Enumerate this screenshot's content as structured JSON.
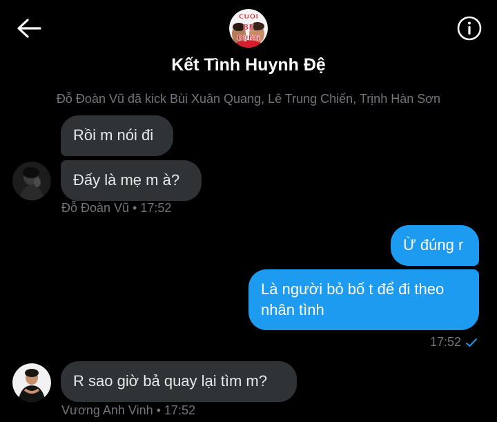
{
  "header": {
    "title": "Kết Tình Huynh Đệ",
    "avatar_text": [
      "CƯỜI",
      "BỂ",
      "BỤNG"
    ],
    "back_icon": "arrow-left-icon",
    "info_icon": "info-icon"
  },
  "system_message": "Đỗ Đoàn Vũ đã kick Bùi Xuân Quang, Lê Trung Chiến, Trịnh Hàn Sơn",
  "messages": [
    {
      "text": "Rồi m nói đi"
    },
    {
      "text": "Đấy là mẹ m à?"
    },
    {
      "text": "Ừ đúng r"
    },
    {
      "text": "Là người bỏ bố t để đi theo nhân tình"
    },
    {
      "text": "R sao giờ bả quay lại tìm m?"
    }
  ],
  "meta": {
    "group1": "Đỗ Đoàn Vũ • 17:52",
    "group2": "17:52",
    "group3": "Vương Anh Vinh • 17:52"
  },
  "colors": {
    "background": "#000000",
    "incoming_bubble": "#2f3336",
    "outgoing_bubble": "#1d9bf0",
    "muted_text": "#71767b",
    "avatar_badge": "#d81e2c"
  }
}
